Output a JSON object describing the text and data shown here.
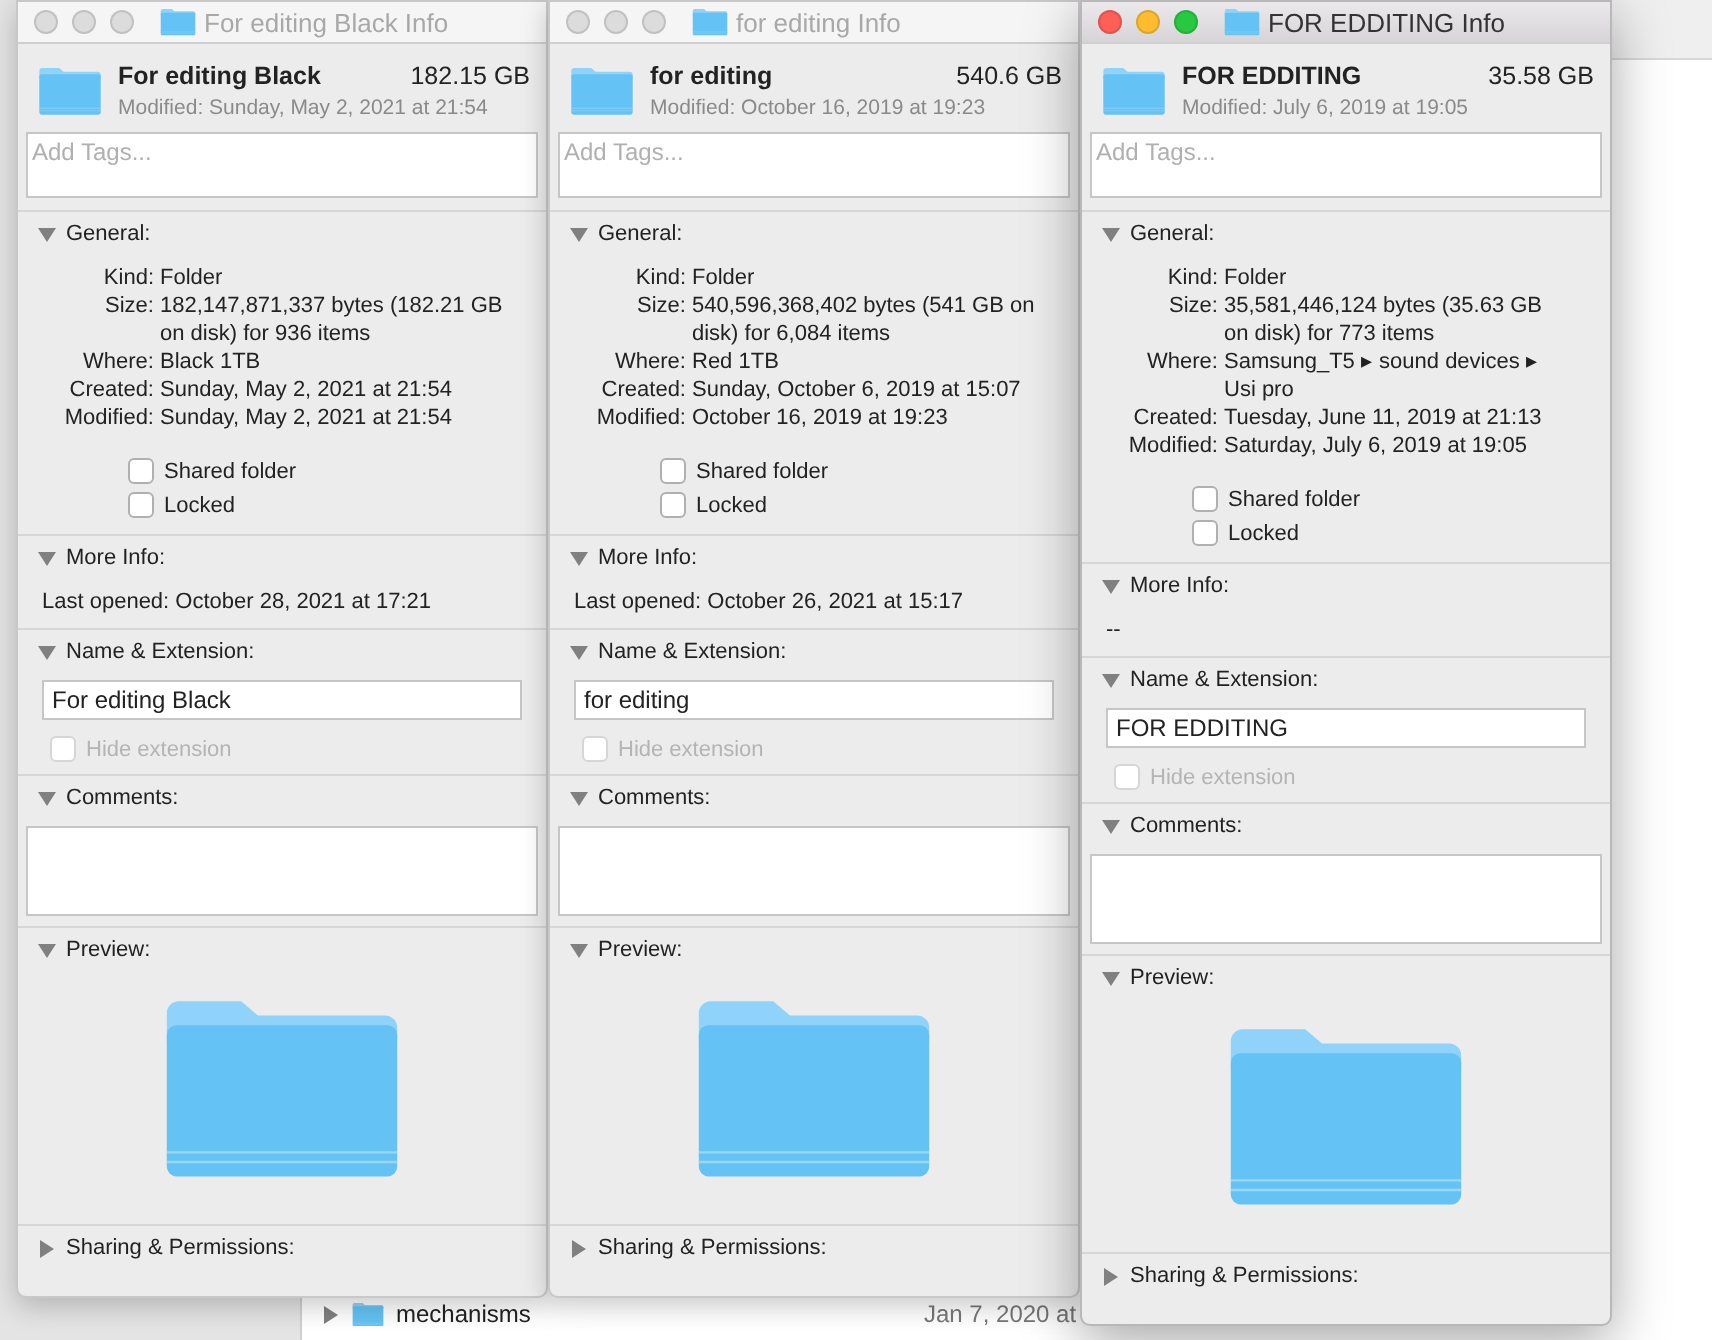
{
  "background_finder": {
    "rows": [
      {
        "name": "mechanisms",
        "date": "Jan 7, 2020 at",
        "expanded": false
      }
    ]
  },
  "windows": [
    {
      "title": "For editing Black Info",
      "active": false,
      "name": "For editing Black",
      "size": "182.15 GB",
      "modified": "Modified: Sunday, May 2, 2021 at 21:54",
      "tags_placeholder": "Add Tags...",
      "general": {
        "title": "General:",
        "expanded": true,
        "rows": [
          {
            "label": "Kind:",
            "value": "Folder"
          },
          {
            "label": "Size:",
            "value": "182,147,871,337 bytes (182.21 GB on disk) for 936 items"
          },
          {
            "label": "Where:",
            "value": "Black 1TB"
          },
          {
            "label": "Created:",
            "value": "Sunday, May 2, 2021 at 21:54"
          },
          {
            "label": "Modified:",
            "value": "Sunday, May 2, 2021 at 21:54"
          }
        ],
        "checkboxes": [
          {
            "label": "Shared folder",
            "checked": false
          },
          {
            "label": "Locked",
            "checked": false
          }
        ]
      },
      "more_info": {
        "title": "More Info:",
        "expanded": true,
        "text": "Last opened: October 28, 2021 at 17:21"
      },
      "name_extension": {
        "title": "Name & Extension:",
        "expanded": true,
        "value": "For editing Black",
        "hide_extension": {
          "label": "Hide extension",
          "checked": false,
          "disabled": true
        }
      },
      "comments": {
        "title": "Comments:",
        "expanded": true
      },
      "preview": {
        "title": "Preview:",
        "expanded": true
      },
      "sharing": {
        "title": "Sharing & Permissions:",
        "expanded": false
      }
    },
    {
      "title": "for editing  Info",
      "active": false,
      "name": "for editing",
      "size": "540.6 GB",
      "modified": "Modified: October 16, 2019 at 19:23",
      "tags_placeholder": "Add Tags...",
      "general": {
        "title": "General:",
        "expanded": true,
        "rows": [
          {
            "label": "Kind:",
            "value": "Folder"
          },
          {
            "label": "Size:",
            "value": "540,596,368,402 bytes (541 GB on disk) for 6,084 items"
          },
          {
            "label": "Where:",
            "value": "Red 1TB"
          },
          {
            "label": "Created:",
            "value": "Sunday, October 6, 2019 at 15:07"
          },
          {
            "label": "Modified:",
            "value": "October 16, 2019 at 19:23"
          }
        ],
        "checkboxes": [
          {
            "label": "Shared folder",
            "checked": false
          },
          {
            "label": "Locked",
            "checked": false
          }
        ]
      },
      "more_info": {
        "title": "More Info:",
        "expanded": true,
        "text": "Last opened: October 26, 2021 at 15:17"
      },
      "name_extension": {
        "title": "Name & Extension:",
        "expanded": true,
        "value": "for editing",
        "hide_extension": {
          "label": "Hide extension",
          "checked": false,
          "disabled": true
        }
      },
      "comments": {
        "title": "Comments:",
        "expanded": true
      },
      "preview": {
        "title": "Preview:",
        "expanded": true
      },
      "sharing": {
        "title": "Sharing & Permissions:",
        "expanded": false
      }
    },
    {
      "title": "FOR EDDITING  Info",
      "active": true,
      "name": "FOR EDDITING",
      "size": "35.58 GB",
      "modified": "Modified: July 6, 2019 at 19:05",
      "tags_placeholder": "Add Tags...",
      "general": {
        "title": "General:",
        "expanded": true,
        "rows": [
          {
            "label": "Kind:",
            "value": "Folder"
          },
          {
            "label": "Size:",
            "value": "35,581,446,124 bytes (35.63 GB on disk) for 773 items"
          },
          {
            "label": "Where:",
            "value": "Samsung_T5 ▸ sound devices ▸ Usi pro"
          },
          {
            "label": "Created:",
            "value": "Tuesday, June 11, 2019 at 21:13"
          },
          {
            "label": "Modified:",
            "value": "Saturday, July 6, 2019 at 19:05"
          }
        ],
        "checkboxes": [
          {
            "label": "Shared folder",
            "checked": false
          },
          {
            "label": "Locked",
            "checked": false
          }
        ]
      },
      "more_info": {
        "title": "More Info:",
        "expanded": true,
        "text": "--"
      },
      "name_extension": {
        "title": "Name & Extension:",
        "expanded": true,
        "value": "FOR EDDITING",
        "hide_extension": {
          "label": "Hide extension",
          "checked": false,
          "disabled": true
        }
      },
      "comments": {
        "title": "Comments:",
        "expanded": true
      },
      "preview": {
        "title": "Preview:",
        "expanded": true
      },
      "sharing": {
        "title": "Sharing & Permissions:",
        "expanded": false
      }
    }
  ]
}
